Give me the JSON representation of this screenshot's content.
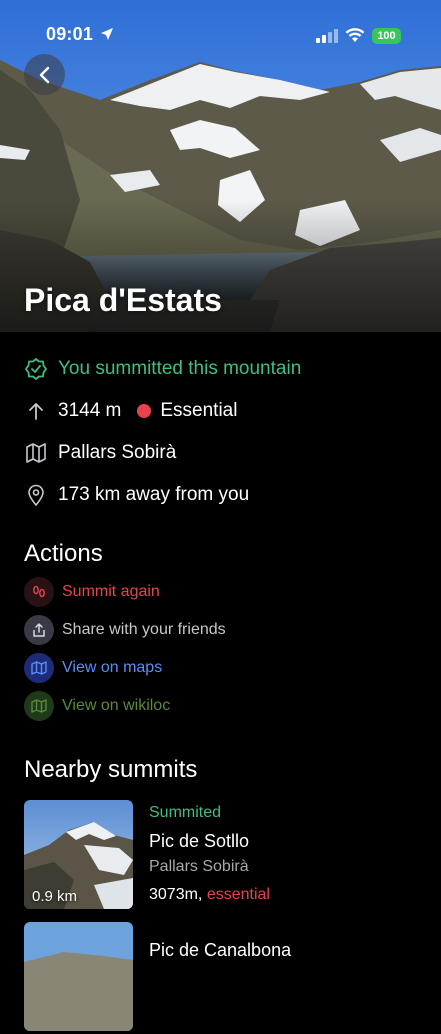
{
  "status_bar": {
    "time": "09:01",
    "battery": "100"
  },
  "mountain": {
    "name": "Pica d'Estats",
    "summited_text": "You summitted this mountain",
    "elevation": "3144 m",
    "category": "Essential",
    "region": "Pallars Sobirà",
    "distance": "173 km away from you"
  },
  "actions": {
    "title": "Actions",
    "items": [
      {
        "label": "Summit again",
        "icon": "footprints-icon"
      },
      {
        "label": "Share with your friends",
        "icon": "share-icon"
      },
      {
        "label": "View on maps",
        "icon": "map-icon"
      },
      {
        "label": "View on wikiloc",
        "icon": "map-icon"
      }
    ]
  },
  "nearby": {
    "title": "Nearby summits",
    "items": [
      {
        "status": "Summited",
        "name": "Pic de Sotllo",
        "region": "Pallars Sobirà",
        "elevation": "3073m,",
        "category": "essential",
        "distance": "0.9 km"
      },
      {
        "status": "",
        "name": "Pic de Canalbona",
        "region": "",
        "elevation": "",
        "category": "",
        "distance": ""
      }
    ]
  },
  "colors": {
    "summited_green": "#3fbf7f",
    "essential_red": "#e8424e",
    "maps_blue": "#5b8ef6",
    "wikiloc_green": "#5a8a3a"
  }
}
